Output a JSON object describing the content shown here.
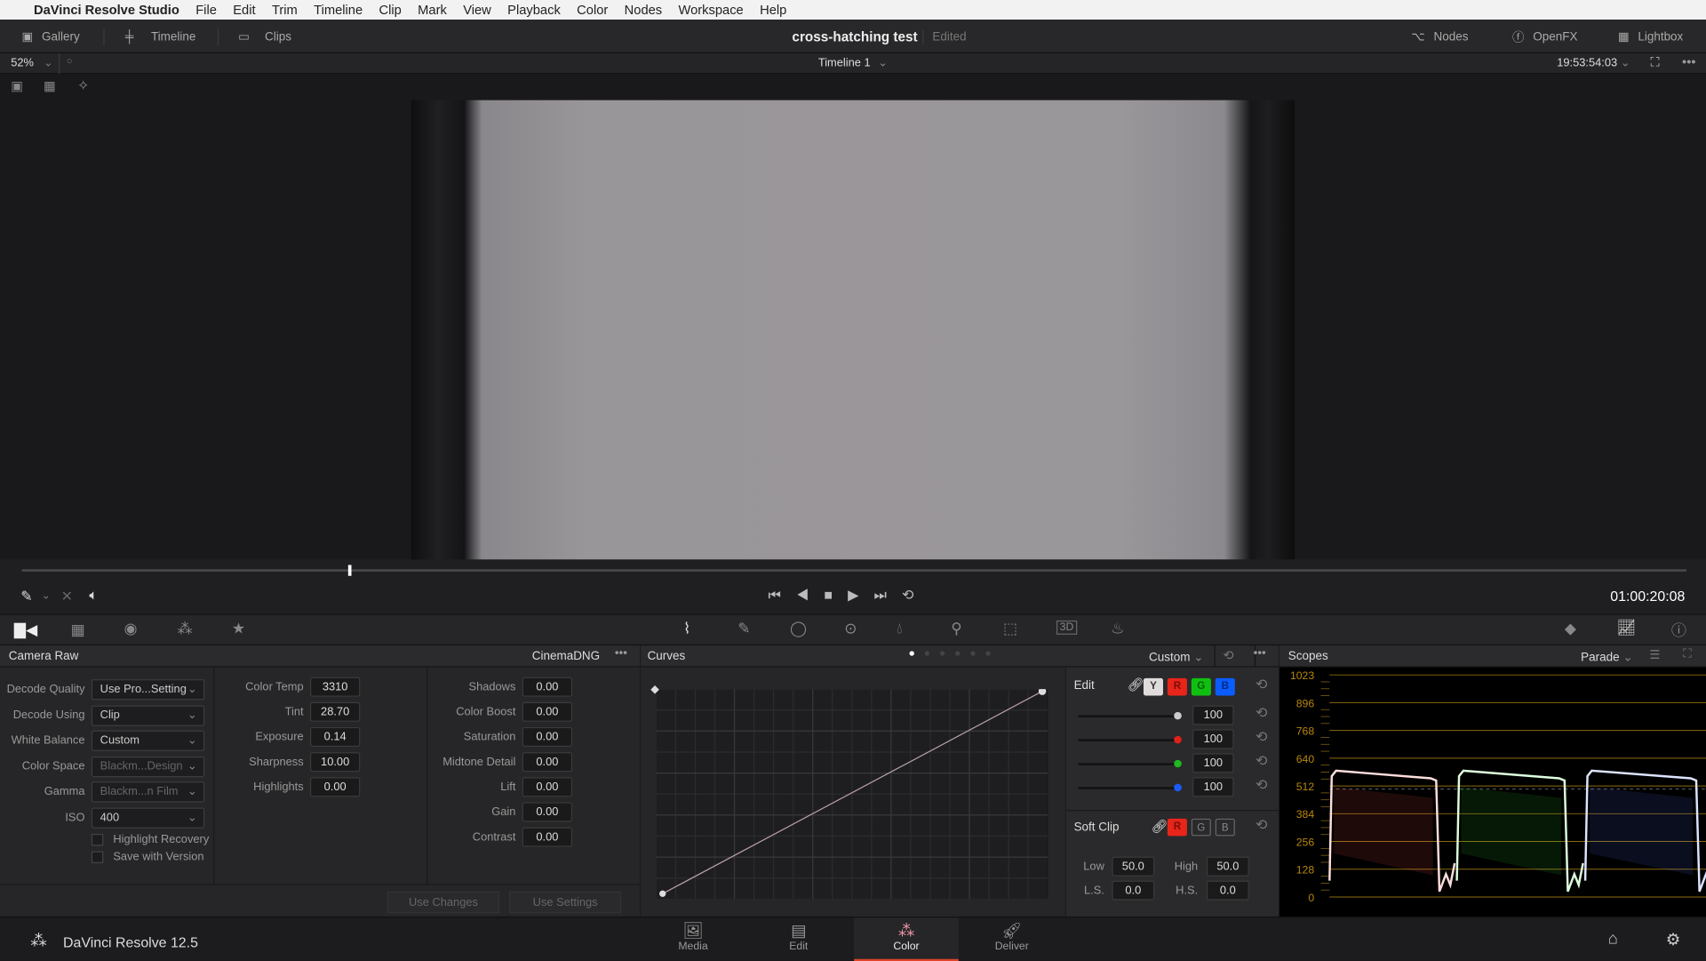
{
  "menubar": {
    "app": "DaVinci Resolve Studio",
    "items": [
      "File",
      "Edit",
      "Trim",
      "Timeline",
      "Clip",
      "Mark",
      "View",
      "Playback",
      "Color",
      "Nodes",
      "Workspace",
      "Help"
    ]
  },
  "topbar": {
    "gallery": "Gallery",
    "timeline": "Timeline",
    "clips": "Clips",
    "project_title": "cross-hatching test",
    "project_status": "Edited",
    "nodes": "Nodes",
    "openfx": "OpenFX",
    "lightbox": "Lightbox"
  },
  "viewer": {
    "zoom": "52%",
    "timeline_name": "Timeline 1",
    "source_timecode": "19:53:54:03",
    "timecode": "01:00:20:08",
    "scrub_position": 0.196
  },
  "camera_raw": {
    "title": "Camera Raw",
    "format": "CinemaDNG",
    "left": [
      {
        "label": "Decode Quality",
        "value": "Use Pro...Setting",
        "enabled": true
      },
      {
        "label": "Decode Using",
        "value": "Clip",
        "enabled": true
      },
      {
        "label": "White Balance",
        "value": "Custom",
        "enabled": true
      },
      {
        "label": "Color Space",
        "value": "Blackm...Design",
        "enabled": false
      },
      {
        "label": "Gamma",
        "value": "Blackm...n Film",
        "enabled": false
      },
      {
        "label": "ISO",
        "value": "400",
        "enabled": true
      }
    ],
    "checkboxes": [
      {
        "label": "Highlight Recovery",
        "checked": false
      },
      {
        "label": "Save with Version",
        "checked": false
      }
    ],
    "mid": [
      {
        "label": "Color Temp",
        "value": "3310"
      },
      {
        "label": "Tint",
        "value": "28.70"
      },
      {
        "label": "Exposure",
        "value": "0.14"
      },
      {
        "label": "Sharpness",
        "value": "10.00"
      },
      {
        "label": "Highlights",
        "value": "0.00"
      }
    ],
    "right": [
      {
        "label": "Shadows",
        "value": "0.00"
      },
      {
        "label": "Color Boost",
        "value": "0.00"
      },
      {
        "label": "Saturation",
        "value": "0.00"
      },
      {
        "label": "Midtone Detail",
        "value": "0.00"
      },
      {
        "label": "Lift",
        "value": "0.00"
      },
      {
        "label": "Gain",
        "value": "0.00"
      },
      {
        "label": "Contrast",
        "value": "0.00"
      }
    ],
    "use_changes": "Use Changes",
    "use_settings": "Use Settings"
  },
  "curves": {
    "title": "Curves",
    "preset": "Custom",
    "edit_label": "Edit",
    "channels": [
      "Y",
      "R",
      "G",
      "B"
    ],
    "intensity": [
      {
        "value": "100",
        "color": "#cccccc"
      },
      {
        "value": "100",
        "color": "#e0201a"
      },
      {
        "value": "100",
        "color": "#1fb81f"
      },
      {
        "value": "100",
        "color": "#1a5cff"
      }
    ],
    "soft_clip": {
      "label": "Soft Clip",
      "channels": [
        "R",
        "G",
        "B"
      ],
      "low_label": "Low",
      "low": "50.0",
      "high_label": "High",
      "high": "50.0",
      "ls_label": "L.S.",
      "ls": "0.0",
      "hs_label": "H.S.",
      "hs": "0.0"
    }
  },
  "scopes": {
    "title": "Scopes",
    "mode": "Parade",
    "scale": [
      "1023",
      "896",
      "768",
      "640",
      "512",
      "384",
      "256",
      "128",
      "0"
    ],
    "colors": {
      "grid": "#8a6a10"
    }
  },
  "bottom": {
    "app_version": "DaVinci Resolve 12.5",
    "pages": [
      "Media",
      "Edit",
      "Color",
      "Deliver"
    ],
    "active_page": "Color"
  }
}
